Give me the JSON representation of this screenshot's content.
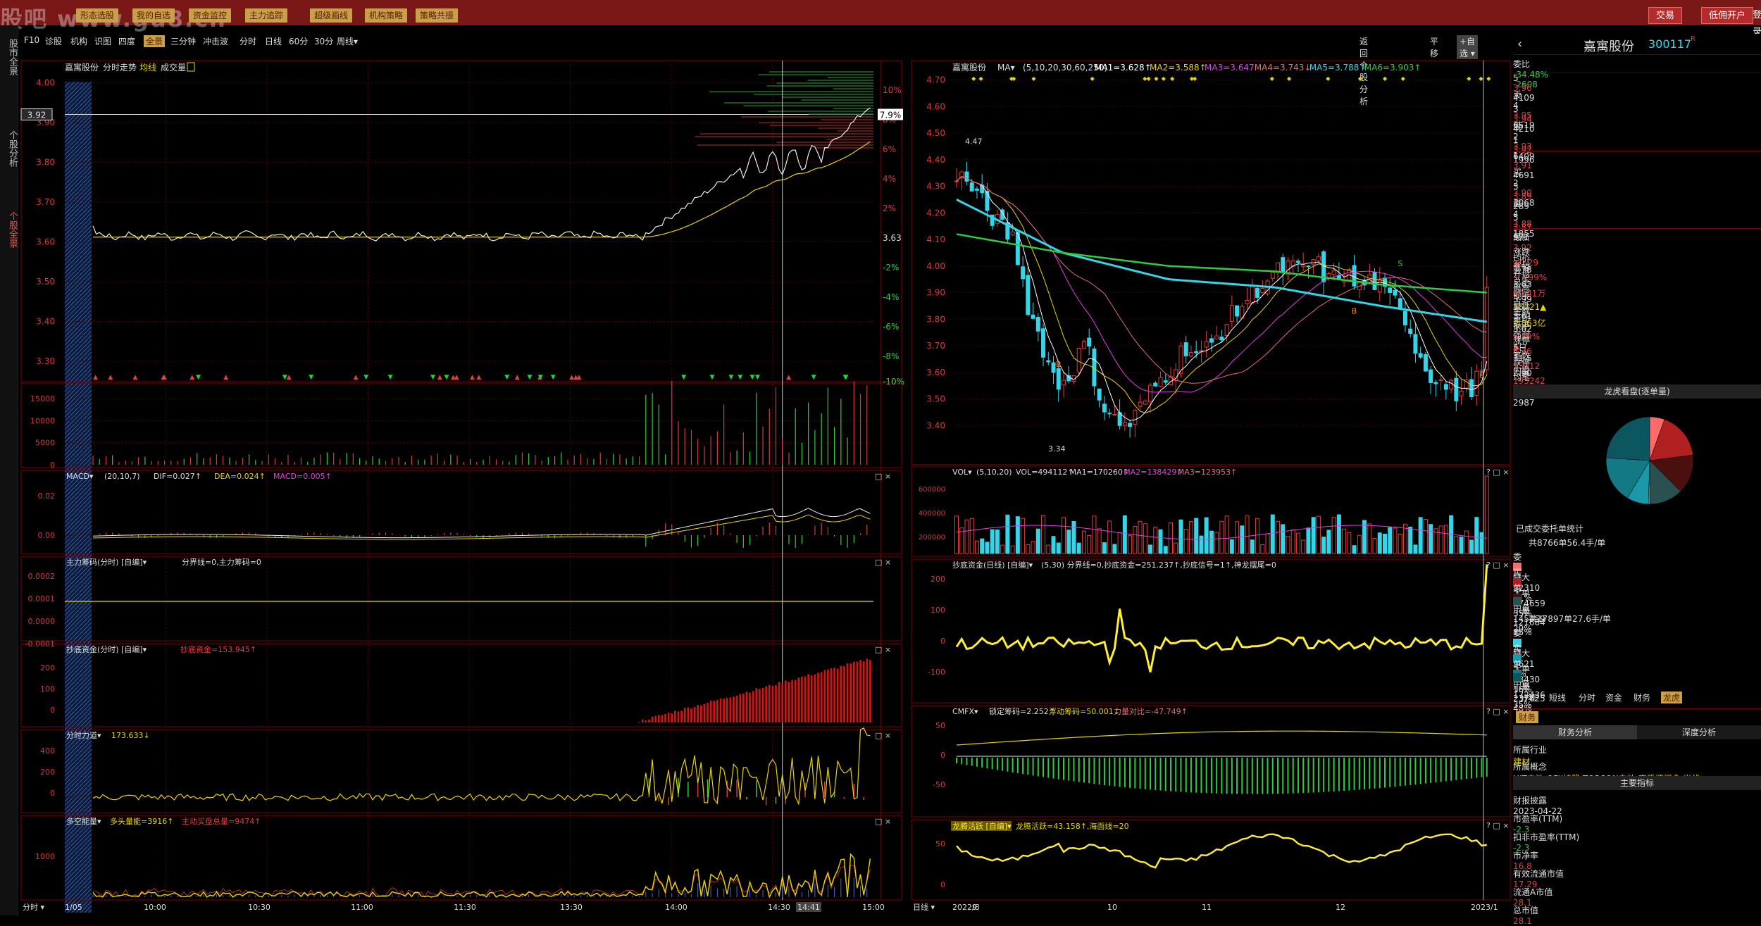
{
  "topbar": {
    "menus": [
      "形态选股",
      "我的自选",
      "资金监控",
      "主力追踪",
      "超级画线",
      "机构策略",
      "策略共振"
    ],
    "watermark": "股吧 www.gu8.cn",
    "right_buttons": [
      "交易",
      "低佣开户",
      "登录"
    ]
  },
  "left_tabs": [
    "股市全景",
    "个股分析",
    "个股全景"
  ],
  "toolbar": {
    "items": [
      "F10",
      "诊股",
      "机构",
      "识图",
      "四度",
      "全景",
      "三分钟",
      "冲击波",
      "分时",
      "日线",
      "60分",
      "30分",
      "周线▾"
    ],
    "active": "全景",
    "right_items": [
      "返回个股分析",
      "平移",
      "+自选 ▾"
    ]
  },
  "intraday": {
    "title_stock": "嘉寓股份",
    "title_mode": "分时走势",
    "title_avg": "均线",
    "title_vol": "成交量",
    "left_ticks": [
      "4.00",
      "3.90",
      "3.80",
      "3.70",
      "3.60",
      "3.50",
      "3.40",
      "3.30"
    ],
    "right_ticks": [
      "10%",
      "8%",
      "6%",
      "4%",
      "2%",
      "3.63",
      "-2%",
      "-4%",
      "-6%",
      "-8%",
      "-10%"
    ],
    "last_price": "3.92",
    "last_pct": "7.9%",
    "vol_ticks": [
      "15000",
      "10000",
      "5000",
      "0"
    ],
    "macd_title": "MACD▾",
    "macd_params": "(20,10,7)",
    "macd_dif": "DIF=0.027↑",
    "macd_dea": "DEA=0.024↑",
    "macd_macd": "MACD=0.005↑",
    "macd_ticks": [
      "0.02",
      "0.00"
    ],
    "main_title": "主力筹码(分时) [自编]▾",
    "main_vals": "分界线=0,主力筹码=0",
    "main_ticks": [
      "0.0002",
      "0.0001",
      "0.0000",
      "-0.0001"
    ],
    "bottom_title": "抄底资金(分时) [自编]▾",
    "bottom_val": "抄底资金=153.945↑",
    "bottom_ticks": [
      "200",
      "100",
      "0"
    ],
    "force_title": "分时力道▾",
    "force_val": "173.633↓",
    "force_ticks": [
      "400",
      "200",
      "0"
    ],
    "ls_title": "多空能量▾",
    "ls_val1": "多头量能=3916↑",
    "ls_val2": "主动买盘总量=9474↑",
    "ls_ticks": [
      "1000"
    ],
    "x_labels": [
      "1/05",
      "10:00",
      "10:30",
      "11:00",
      "11:30",
      "13:30",
      "14:00",
      "14:30",
      "14:41",
      "15:00"
    ],
    "x_prefix": "分时 ▾",
    "chart_data": {
      "type": "line",
      "x": [
        "09:30",
        "10:00",
        "10:30",
        "11:00",
        "11:30",
        "13:30",
        "14:00",
        "14:30",
        "15:00"
      ],
      "series": [
        {
          "values": [
            3.64,
            3.61,
            3.62,
            3.62,
            3.62,
            3.62,
            3.62,
            3.82,
            3.92
          ]
        },
        {
          "values": [
            3.63,
            3.61,
            3.61,
            3.61,
            3.61,
            3.61,
            3.62,
            3.72,
            3.78
          ]
        }
      ],
      "ylim": [
        3.27,
        4.02
      ]
    }
  },
  "daily": {
    "title_stock": "嘉寓股份",
    "ma_label": "MA▾",
    "ma_params": "(5,10,20,30,60,250)",
    "ma_vals": [
      {
        "t": "MA1=3.628↑",
        "c": "#ffffff"
      },
      {
        "t": "MA2=3.588↑",
        "c": "#e6d400"
      },
      {
        "t": "MA3=3.647",
        "c": "#e040e0"
      },
      {
        "t": "MA4=3.743↓",
        "c": "#e07070"
      },
      {
        "t": "MA5=3.788↑",
        "c": "#33d6e8"
      },
      {
        "t": "MA6=3.903↑",
        "c": "#2ecc40"
      }
    ],
    "y_ticks": [
      "4.70",
      "4.60",
      "4.50",
      "4.40",
      "4.30",
      "4.20",
      "4.10",
      "4.00",
      "3.90",
      "3.80",
      "3.70",
      "3.60",
      "3.50",
      "3.40"
    ],
    "hi_label": "4.47",
    "lo_label": "3.34",
    "vol_title": "VOL▾",
    "vol_params": "(5,10,20)",
    "vol_vals": [
      {
        "t": "VOL=494112↑",
        "c": "#ddd"
      },
      {
        "t": "MA1=170260↑",
        "c": "#ddd"
      },
      {
        "t": "MA2=138429↑",
        "c": "#e040e0"
      },
      {
        "t": "MA3=123953↑",
        "c": "#e07070"
      }
    ],
    "vol_ticks": [
      "600000",
      "400000",
      "200000"
    ],
    "cd_title": "抄底资金(日线) [自编]▾",
    "cd_vals": "(5,30) 分界线=0,抄底资金=251.237↑,抄底信号=1↑,神龙摆尾=0",
    "cd_ticks": [
      "200",
      "100",
      "0",
      "-100"
    ],
    "cmfx_title": "CMFX▾",
    "cmfx_vals": [
      {
        "t": "锁定筹码=2.252↑",
        "c": "#ddd"
      },
      {
        "t": "浮动筹码=50.001↓",
        "c": "#e6d400"
      },
      {
        "t": "力量对比=-47.749↑",
        "c": "#e07070"
      }
    ],
    "cmfx_ticks": [
      "50",
      "0",
      "-50"
    ],
    "lt_title": "龙腾活跃 [自编]▾",
    "lt_vals": "龙腾活跃=43.158↑,海面线=20",
    "lt_ticks": [
      "50",
      "0"
    ],
    "x_labels": [
      "2022/8",
      "9",
      "10",
      "11",
      "12",
      "2023/1"
    ],
    "x_prefix": "日线 ▾",
    "marks": [
      "B",
      "B",
      "S",
      "B"
    ],
    "chart_data": {
      "type": "line",
      "x": [
        "2022/8",
        "9",
        "10",
        "11",
        "12",
        "2023/1"
      ],
      "series": [
        {
          "name": "MA5",
          "values": [
            4.25,
            4.05,
            3.95,
            3.92,
            3.85,
            3.79
          ]
        },
        {
          "name": "MA6",
          "values": [
            4.12,
            4.05,
            4.0,
            3.98,
            3.93,
            3.9
          ]
        }
      ],
      "ylim": [
        3.3,
        4.72
      ]
    }
  },
  "quote": {
    "stock_name": "嘉寓股份",
    "stock_code": "300117",
    "tag": "R",
    "wb_label": "委比",
    "wb_val": "-34.48%",
    "wc_val": "-2608",
    "asks": [
      {
        "l": "5",
        "p": "3.96",
        "v": "4109"
      },
      {
        "l": "4",
        "p": "3.95",
        "v": "6519"
      },
      {
        "l": "3",
        "p": "3.94",
        "v": "4210"
      },
      {
        "l": "2",
        "p": "3.93",
        "v": "6409"
      },
      {
        "l": "1",
        "p": "3.92",
        "v": "1996"
      }
    ],
    "bids": [
      {
        "l": "1",
        "p": "3.91",
        "v": "4691"
      },
      {
        "l": "2",
        "p": "3.90",
        "v": "3068"
      },
      {
        "l": "3",
        "p": "3.89",
        "v": "289"
      },
      {
        "l": "4",
        "p": "3.88",
        "v": "1855"
      },
      {
        "l": "5",
        "p": "3.87",
        "v": "971"
      }
    ],
    "sell_side": "卖",
    "buy_side": "买",
    "pan": "盘",
    "stats": [
      {
        "a": "最新",
        "b": "3.92",
        "c": "均价",
        "d": "3.78"
      },
      {
        "a": "涨跌",
        "b": "▲0.29",
        "c": "开盘",
        "d": "3.63"
      },
      {
        "a": "涨幅",
        "b": "+7.99%",
        "c": "最高",
        "d": "3.99"
      },
      {
        "a": "总手",
        "b": "49.41万",
        "c": "最低",
        "d": "3.61"
      },
      {
        "a": "现手",
        "b": "15721▲",
        "c": "量比",
        "d": "3.62"
      },
      {
        "a": "金额",
        "b": "1.863亿",
        "c": "强弱",
        "d": "▲"
      },
      {
        "a": "换手",
        "b": "6.89%",
        "c": "5日",
        "d": "11.5"
      },
      {
        "a": "涨停",
        "b": "4.36",
        "c": "跌停",
        "d": "2.90"
      },
      {
        "a": "笔数",
        "b": "25912",
        "c": "均笔",
        "d": "19.1"
      },
      {
        "a": "内盘",
        "b": "195242",
        "c": "外盘",
        "d": "2987"
      }
    ],
    "lh_title": "龙虎看盘(逐单量)",
    "pie_segments": [
      {
        "v": 11,
        "c": "#ff6a6a"
      },
      {
        "v": 35,
        "c": "#b02020"
      },
      {
        "v": 29,
        "c": "#4a1010"
      },
      {
        "v": 25,
        "c": "#2a5050"
      },
      {
        "v": 1,
        "c": "#33d6e8"
      },
      {
        "v": 16,
        "c": "#1a9aa8"
      },
      {
        "v": 35,
        "c": "#137a85"
      },
      {
        "v": 48,
        "c": "#0c5660"
      }
    ],
    "deal_title": "已成交委托单统计",
    "buy_total": "共8766单56.4手/单",
    "buy_rows": [
      {
        "s": "委",
        "n": "特大",
        "v": "52310",
        "p": "11%",
        "c": "#ff6a6a"
      },
      {
        "s": "买",
        "n": "大单",
        "v": "174659",
        "p": "35%",
        "c": "#b02020"
      },
      {
        "s": "单",
        "n": "中单",
        "v": "145459",
        "p": "29%",
        "c": "#4a1010"
      },
      {
        "s": "",
        "n": "小单",
        "v": "121684",
        "p": "25%",
        "c": "#2a5050"
      }
    ],
    "sell_total": "共17897单27.6手/单",
    "sell_rows": [
      {
        "s": "委",
        "n": "特大",
        "v": "5621",
        "p": "1%",
        "c": "#33d6e8"
      },
      {
        "s": "卖",
        "n": "大单",
        "v": "78430",
        "p": "16%",
        "c": "#1a9aa8"
      },
      {
        "s": "单",
        "n": "中单",
        "v": "172436",
        "p": "35%",
        "c": "#137a85"
      },
      {
        "s": "",
        "n": "小单",
        "v": "237625",
        "p": "48%",
        "c": "#0c5660"
      }
    ],
    "tabs": [
      "分笔",
      "短线",
      "分时",
      "资金",
      "财务",
      "龙虎"
    ],
    "active_tab": "龙虎",
    "fin_tab": "财务",
    "fin_sub": [
      "财务分析",
      "深度分析"
    ],
    "industry_l": "所属行业",
    "industry_v": "建材",
    "concept_l": "所属概念",
    "concept_v": "HJT电池,QFII持股,TOPCON电池,高质押概念,光伏",
    "indicator_title": "主要指标",
    "fin_rows": [
      {
        "l": "财报披露",
        "v": "2023-04-22"
      },
      {
        "l": "市盈率(TTM)",
        "v": "-2.3"
      },
      {
        "l": "扣非市盈率(TTM)",
        "v": "-2.3"
      },
      {
        "l": "市净率",
        "v": "16.8"
      },
      {
        "l": "有效流通市值",
        "v": "17.29"
      },
      {
        "l": "流通A市值",
        "v": "28.1"
      },
      {
        "l": "总市值",
        "v": "28.1"
      }
    ]
  }
}
